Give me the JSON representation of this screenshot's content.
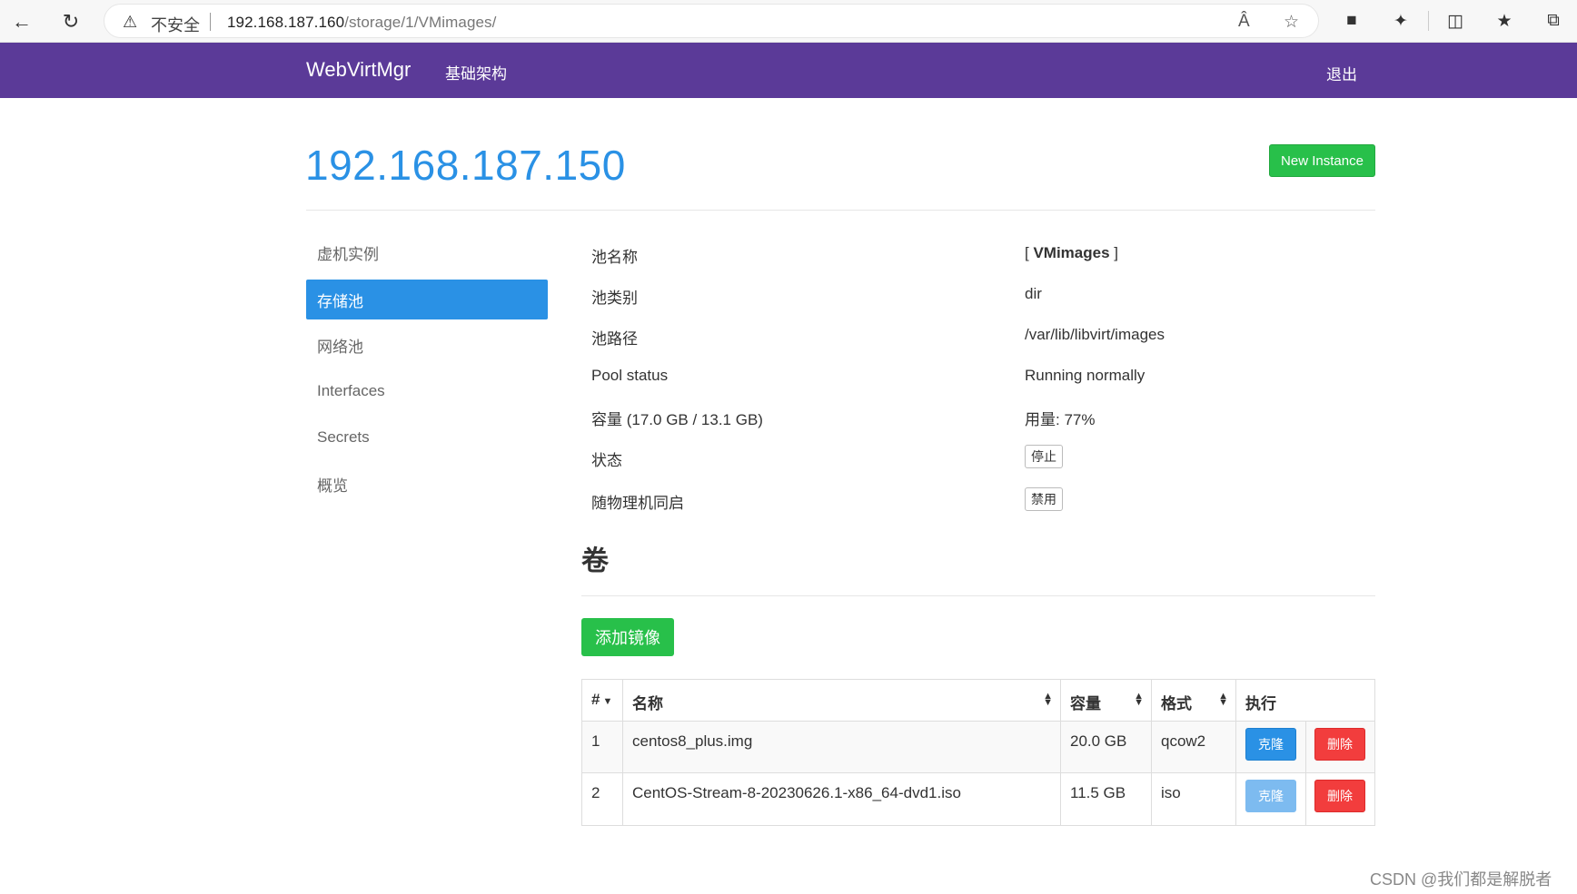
{
  "browser": {
    "security_label": "不安全",
    "url_host": "192.168.187.160",
    "url_path": "/storage/1/VMimages/"
  },
  "navbar": {
    "brand": "WebVirtMgr",
    "infrastructure_link": "基础架构",
    "logout": "退出"
  },
  "header": {
    "host_title": "192.168.187.150",
    "new_instance_button": "New Instance"
  },
  "sidebar": {
    "items": [
      {
        "label": "虚机实例"
      },
      {
        "label": "存储池"
      },
      {
        "label": "网络池"
      },
      {
        "label": "Interfaces"
      },
      {
        "label": "Secrets"
      },
      {
        "label": "概览"
      }
    ]
  },
  "pool_info": {
    "name_label": "池名称",
    "name_prefix": "[ ",
    "name_value": "VMimages",
    "name_suffix": " ]",
    "type_label": "池类别",
    "type_value": "dir",
    "path_label": "池路径",
    "path_value": "/var/lib/libvirt/images",
    "status_label": "Pool status",
    "status_value": "Running normally",
    "capacity_label": "容量 (17.0 GB / 13.1 GB)",
    "usage_value": "用量: 77%",
    "state_label": "状态",
    "state_button": "停止",
    "autostart_label": "随物理机同启",
    "autostart_button": "禁用"
  },
  "volumes": {
    "title": "卷",
    "add_button": "添加镜像",
    "columns": [
      "#",
      "名称",
      "容量",
      "格式",
      "执行"
    ],
    "rows": [
      {
        "index": "1",
        "name": "centos8_plus.img",
        "size": "20.0 GB",
        "format": "qcow2",
        "clone": "克隆",
        "delete": "删除"
      },
      {
        "index": "2",
        "name": "CentOS-Stream-8-20230626.1-x86_64-dvd1.iso",
        "size": "11.5 GB",
        "format": "iso",
        "clone": "克隆",
        "delete": "删除"
      }
    ]
  },
  "watermark": "CSDN @我们都是解脱者",
  "colors": {
    "navbar": "#5b3a98",
    "accent_blue": "#2a91e5",
    "success_green": "#28c04a",
    "danger_red": "#f23d3d"
  }
}
